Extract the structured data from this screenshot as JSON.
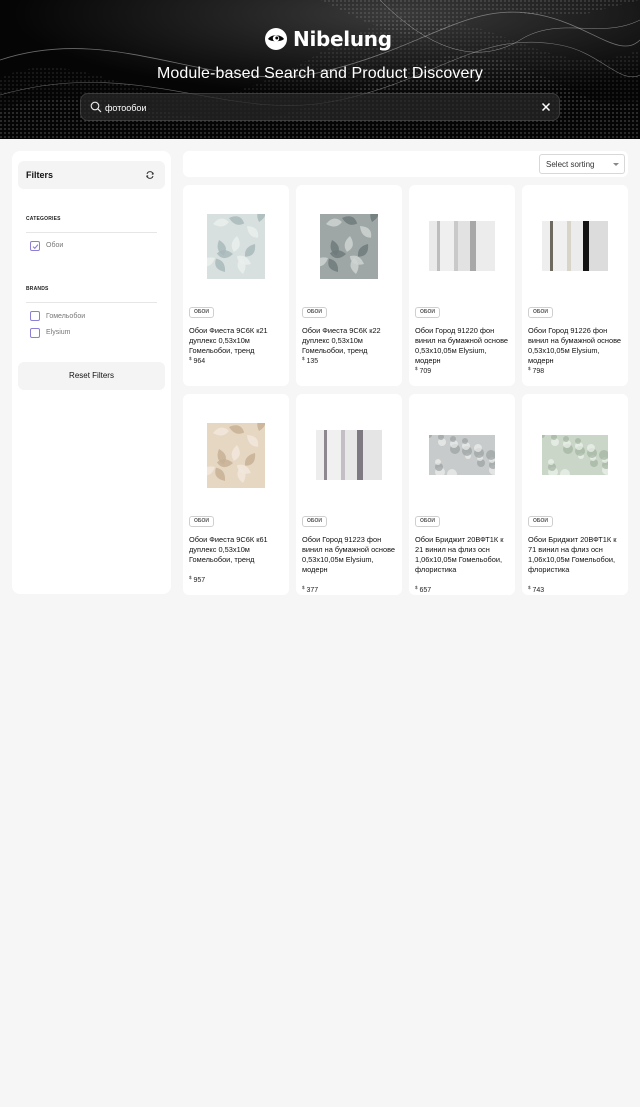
{
  "brand": {
    "name": "Nibelung"
  },
  "hero": {
    "title": "Module-based Search and Product Discovery"
  },
  "search": {
    "value": "фотообои",
    "icon": "search-icon",
    "clear_icon": "close-icon"
  },
  "sidebar": {
    "title": "Filters",
    "categories_label": "CATEGORIES",
    "categories": [
      {
        "label": "Обои",
        "checked": true
      }
    ],
    "brands_label": "BRANDS",
    "brands": [
      {
        "label": "Гомельобои",
        "checked": false
      },
      {
        "label": "Elysium",
        "checked": false
      }
    ],
    "reset_label": "Reset Filters"
  },
  "sort": {
    "label": "Select sorting"
  },
  "currency": "$",
  "products": [
    {
      "badge": "ОБОИ",
      "name": "Обои Фиеста 9С6К к21 дуплекс 0,53x10м Гомельобои, тренд",
      "price": "964",
      "pattern": "leaves-light"
    },
    {
      "badge": "ОБОИ",
      "name": "Обои Фиеста 9С6К к22 дуплекс 0,53x10м Гомельобои, тренд",
      "price": "135",
      "pattern": "leaves-dark"
    },
    {
      "badge": "ОБОИ",
      "name": "Обои Город 91220 фон винил на бумажной основе 0,53x10,05м Elysium, модерн",
      "price": "709",
      "pattern": "stripes-grey"
    },
    {
      "badge": "ОБОИ",
      "name": "Обои Город 91226 фон винил на бумажной основе 0,53x10,05м Elysium, модерн",
      "price": "798",
      "pattern": "stripes-black"
    },
    {
      "badge": "ОБОИ",
      "name": "Обои Фиеста 9С6К к61 дуплекс 0,53x10м Гомельобои, тренд",
      "price": "957",
      "pattern": "leaves-beige"
    },
    {
      "badge": "ОБОИ",
      "name": "Обои Город 91223 фон винил на бумажной основе 0,53x10,05м Elysium, модерн",
      "price": "377",
      "pattern": "stripes-mauve"
    },
    {
      "badge": "ОБОИ",
      "name": "Обои Бриджит 20ВФТ1К к 21 винил на флиз осн 1,06x10,05м Гомельобои, флористика",
      "price": "657",
      "pattern": "floral-grey"
    },
    {
      "badge": "ОБОИ",
      "name": "Обои Бриджит 20ВФТ1К к 71 винил на флиз осн 1,06x10,05м Гомельобои, флористика",
      "price": "743",
      "pattern": "floral-green"
    }
  ],
  "colors": {
    "accent": "#8b7fd6",
    "hero_bg": "#050505",
    "page_bg": "#f6f6f6"
  }
}
